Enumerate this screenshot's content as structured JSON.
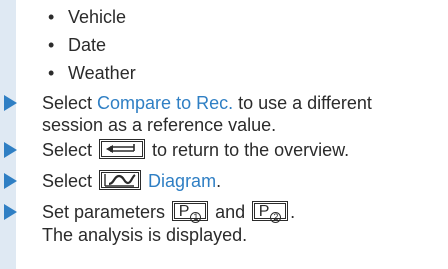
{
  "bullets": [
    "Vehicle",
    "Date",
    "Weather"
  ],
  "bullet_glyph": "•",
  "steps": {
    "compare": {
      "prefix": "Select ",
      "link": "Compare to Rec.",
      "suffix": " to use a different",
      "line2": "session as a reference value."
    },
    "back": {
      "prefix": "Select ",
      "icon": "return-arrow-icon",
      "suffix": " to return to the overview."
    },
    "diagram": {
      "prefix": "Select ",
      "icon": "diagram-curve-icon",
      "link": "Diagram",
      "suffix": "."
    },
    "params": {
      "prefix": "Set parameters ",
      "p1": "P",
      "p1_sub": "1",
      "middle": " and ",
      "p2": "P",
      "p2_sub": "2",
      "suffix": ".",
      "line2": "The analysis is displayed."
    }
  },
  "colors": {
    "accent": "#2f7fc4",
    "side_bar": "#dfe9f3",
    "text": "#2b2b2b"
  }
}
